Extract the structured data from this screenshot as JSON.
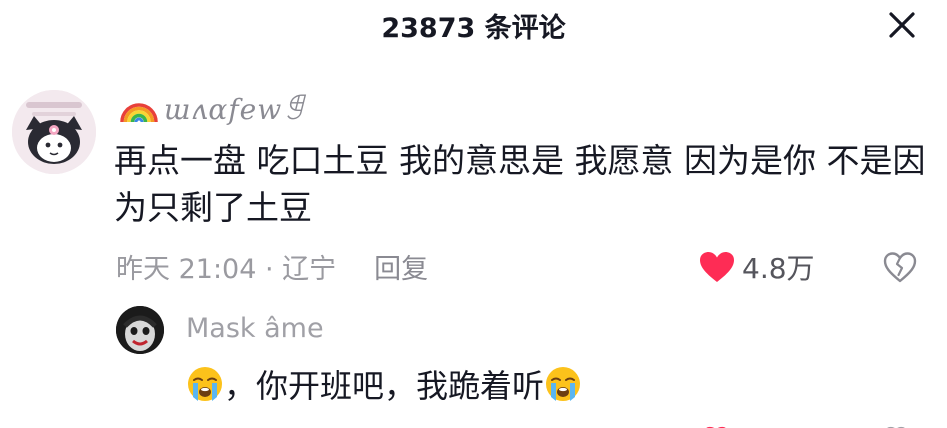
{
  "header": {
    "title": "23873 条评论"
  },
  "comment": {
    "username": "ɯʌɑfewꁅ",
    "text": "再点一盘 吃口土豆 我的意思是 我愿意 因为是你 不是因为只剩了土豆",
    "time_location": "昨天 21:04 · 辽宁",
    "reply_label": "回复",
    "like_count": "4.8万",
    "heart_color": "#fe2c55"
  },
  "reply": {
    "username": "Mask âme",
    "text": "，你开班吧，我跪着听"
  },
  "icons": {
    "close": "close-icon",
    "rainbow": "rainbow-icon",
    "heart": "heart-icon",
    "dislike": "broken-heart-icon",
    "emoji": "loudly-crying-face-emoji"
  }
}
